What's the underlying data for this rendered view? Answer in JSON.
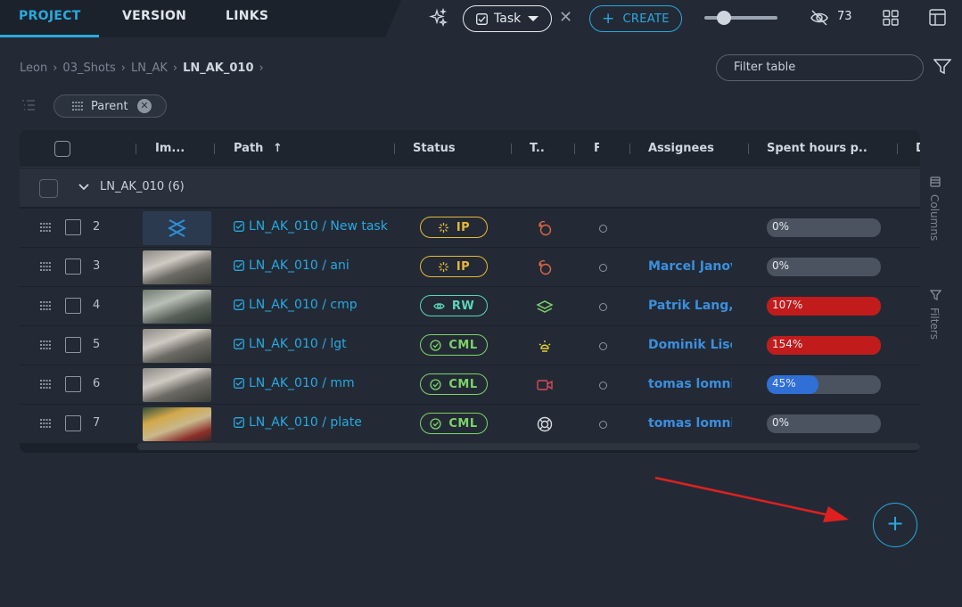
{
  "nav": {
    "tabs": [
      "PROJECT",
      "VERSION",
      "LINKS"
    ],
    "active_tab": "PROJECT"
  },
  "toolbar": {
    "entity_type": "Task",
    "create_label": "CREATE",
    "hidden_count": "73"
  },
  "breadcrumb": [
    "Leon",
    "03_Shots",
    "LN_AK",
    "LN_AK_010"
  ],
  "filter": {
    "placeholder": "Filter table"
  },
  "groupby": {
    "chip_label": "Parent"
  },
  "table": {
    "headers": [
      "Im...",
      "Path",
      "Status",
      "T..",
      "F",
      "Assignees",
      "Spent hours p...",
      "D"
    ],
    "group": {
      "label": "LN_AK_010 (6)"
    },
    "rows": [
      {
        "num": "2",
        "path": "LN_AK_010 / New task",
        "status": "IP",
        "assignee": "",
        "progress": "0%",
        "progress_value": 0
      },
      {
        "num": "3",
        "path": "LN_AK_010 / ani",
        "status": "IP",
        "assignee": "Marcel Janov",
        "progress": "0%",
        "progress_value": 0
      },
      {
        "num": "4",
        "path": "LN_AK_010 / cmp",
        "status": "RW",
        "assignee": "Patrik Lang,",
        "progress": "107%",
        "progress_value": 107
      },
      {
        "num": "5",
        "path": "LN_AK_010 / lgt",
        "status": "CML",
        "assignee": "Dominik Lisc",
        "progress": "154%",
        "progress_value": 154
      },
      {
        "num": "6",
        "path": "LN_AK_010 / mm",
        "status": "CML",
        "assignee": "tomas lomni",
        "progress": "45%",
        "progress_value": 45
      },
      {
        "num": "7",
        "path": "LN_AK_010 / plate",
        "status": "CML",
        "assignee": "tomas lomni",
        "progress": "0%",
        "progress_value": 0
      }
    ]
  },
  "side_panel": {
    "columns_label": "Columns",
    "filters_label": "Filters"
  },
  "colors": {
    "accent": "#29a9e0",
    "ip": "#e6b93a",
    "rw": "#5cd6b8",
    "cml": "#7ed36b",
    "over": "#c21b1b",
    "progress_blue": "#2f6fd6"
  }
}
